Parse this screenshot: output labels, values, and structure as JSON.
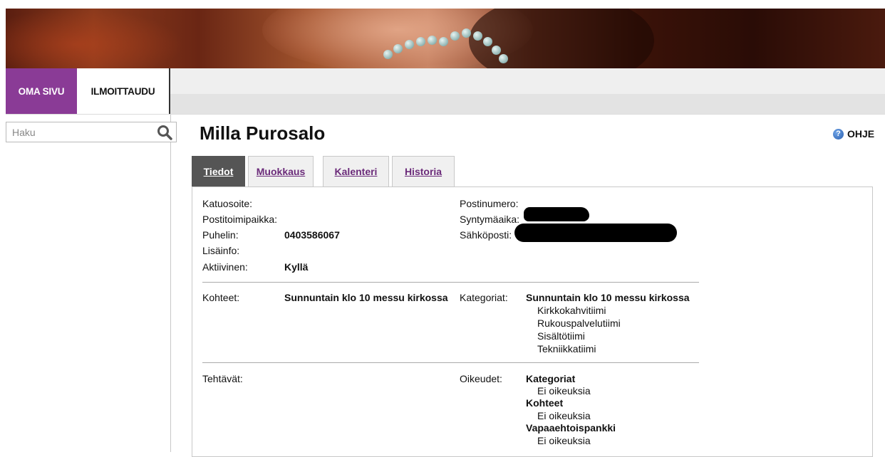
{
  "nav": {
    "tabs": [
      {
        "label": "OMA SIVU",
        "active": true
      },
      {
        "label": "ILMOITTAUDU",
        "active": false
      }
    ]
  },
  "search": {
    "placeholder": "Haku",
    "value": ""
  },
  "page": {
    "title": "Milla Purosalo",
    "help_label": "OHJE"
  },
  "tabs": [
    {
      "label": "Tiedot",
      "active": true
    },
    {
      "label": "Muokkaus",
      "active": false
    },
    {
      "label": "Kalenteri",
      "active": false
    },
    {
      "label": "Historia",
      "active": false
    }
  ],
  "details": {
    "katuosoite_label": "Katuosoite:",
    "postitoimipaikka_label": "Postitoimipaikka:",
    "puhelin_label": "Puhelin:",
    "puhelin_value": "0403586067",
    "lisainfo_label": "Lisäinfo:",
    "aktiivinen_label": "Aktiivinen:",
    "aktiivinen_value": "Kyllä",
    "postinumero_label": "Postinumero:",
    "syntymaaika_label": "Syntymäaika:",
    "sahkoposti_label": "Sähköposti:"
  },
  "targets": {
    "kohteet_label": "Kohteet:",
    "kohteet_value": "Sunnuntain klo 10 messu kirkossa",
    "kategoriat_label": "Kategoriat:",
    "kategoriat_heading": "Sunnuntain klo 10 messu kirkossa",
    "kategoriat_items": [
      "Kirkkokahvitiimi",
      "Rukouspalvelutiimi",
      "Sisältötiimi",
      "Tekniikkatiimi"
    ]
  },
  "duties": {
    "tehtavat_label": "Tehtävät:",
    "oikeudet_label": "Oikeudet:",
    "groups": [
      {
        "heading": "Kategoriat",
        "value": "Ei oikeuksia"
      },
      {
        "heading": "Kohteet",
        "value": "Ei oikeuksia"
      },
      {
        "heading": "Vapaaehtoispankki",
        "value": "Ei oikeuksia"
      }
    ]
  },
  "colors": {
    "accent": "#8a3b96",
    "active_tab": "#555555",
    "link": "#6b2b7a"
  }
}
